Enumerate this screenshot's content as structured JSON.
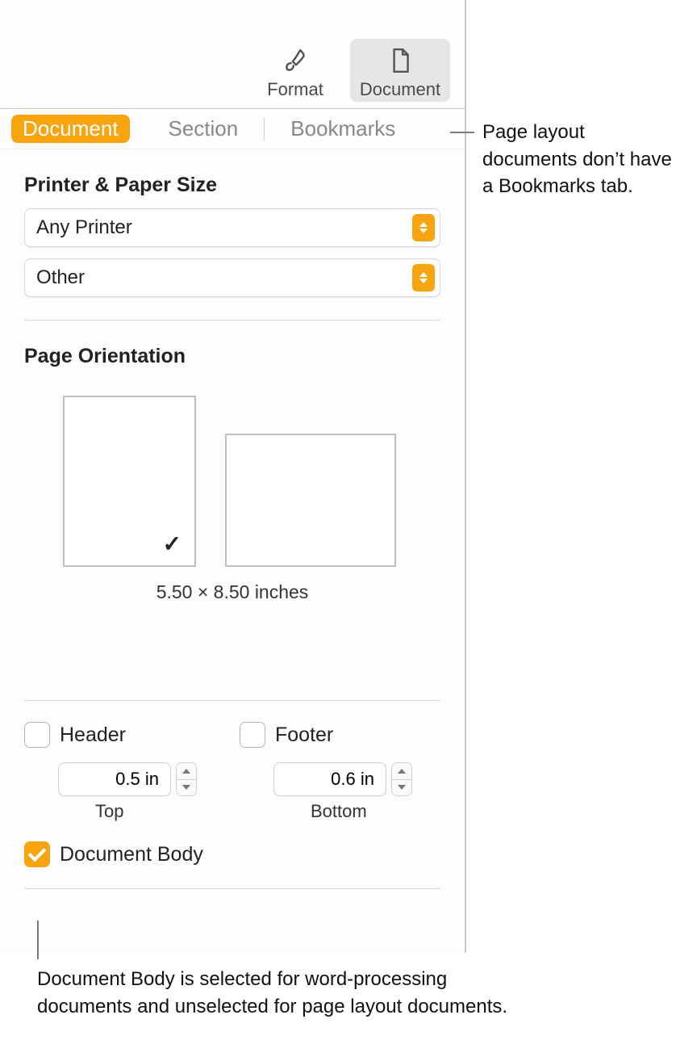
{
  "toolbar": {
    "format_label": "Format",
    "document_label": "Document"
  },
  "tabs": {
    "document": "Document",
    "section": "Section",
    "bookmarks": "Bookmarks"
  },
  "printer": {
    "title": "Printer & Paper Size",
    "printer_value": "Any Printer",
    "paper_value": "Other"
  },
  "orientation": {
    "title": "Page Orientation",
    "dimensions": "5.50 × 8.50 inches",
    "check": "✓"
  },
  "hf": {
    "header_label": "Header",
    "footer_label": "Footer",
    "header_value": "0.5 in",
    "footer_value": "0.6 in",
    "top_label": "Top",
    "bottom_label": "Bottom"
  },
  "docbody": {
    "label": "Document Body"
  },
  "callouts": {
    "bookmarks": "Page layout documents don’t have a Bookmarks tab.",
    "docbody": "Document Body is selected for word-processing documents and unselected for page layout documents."
  }
}
